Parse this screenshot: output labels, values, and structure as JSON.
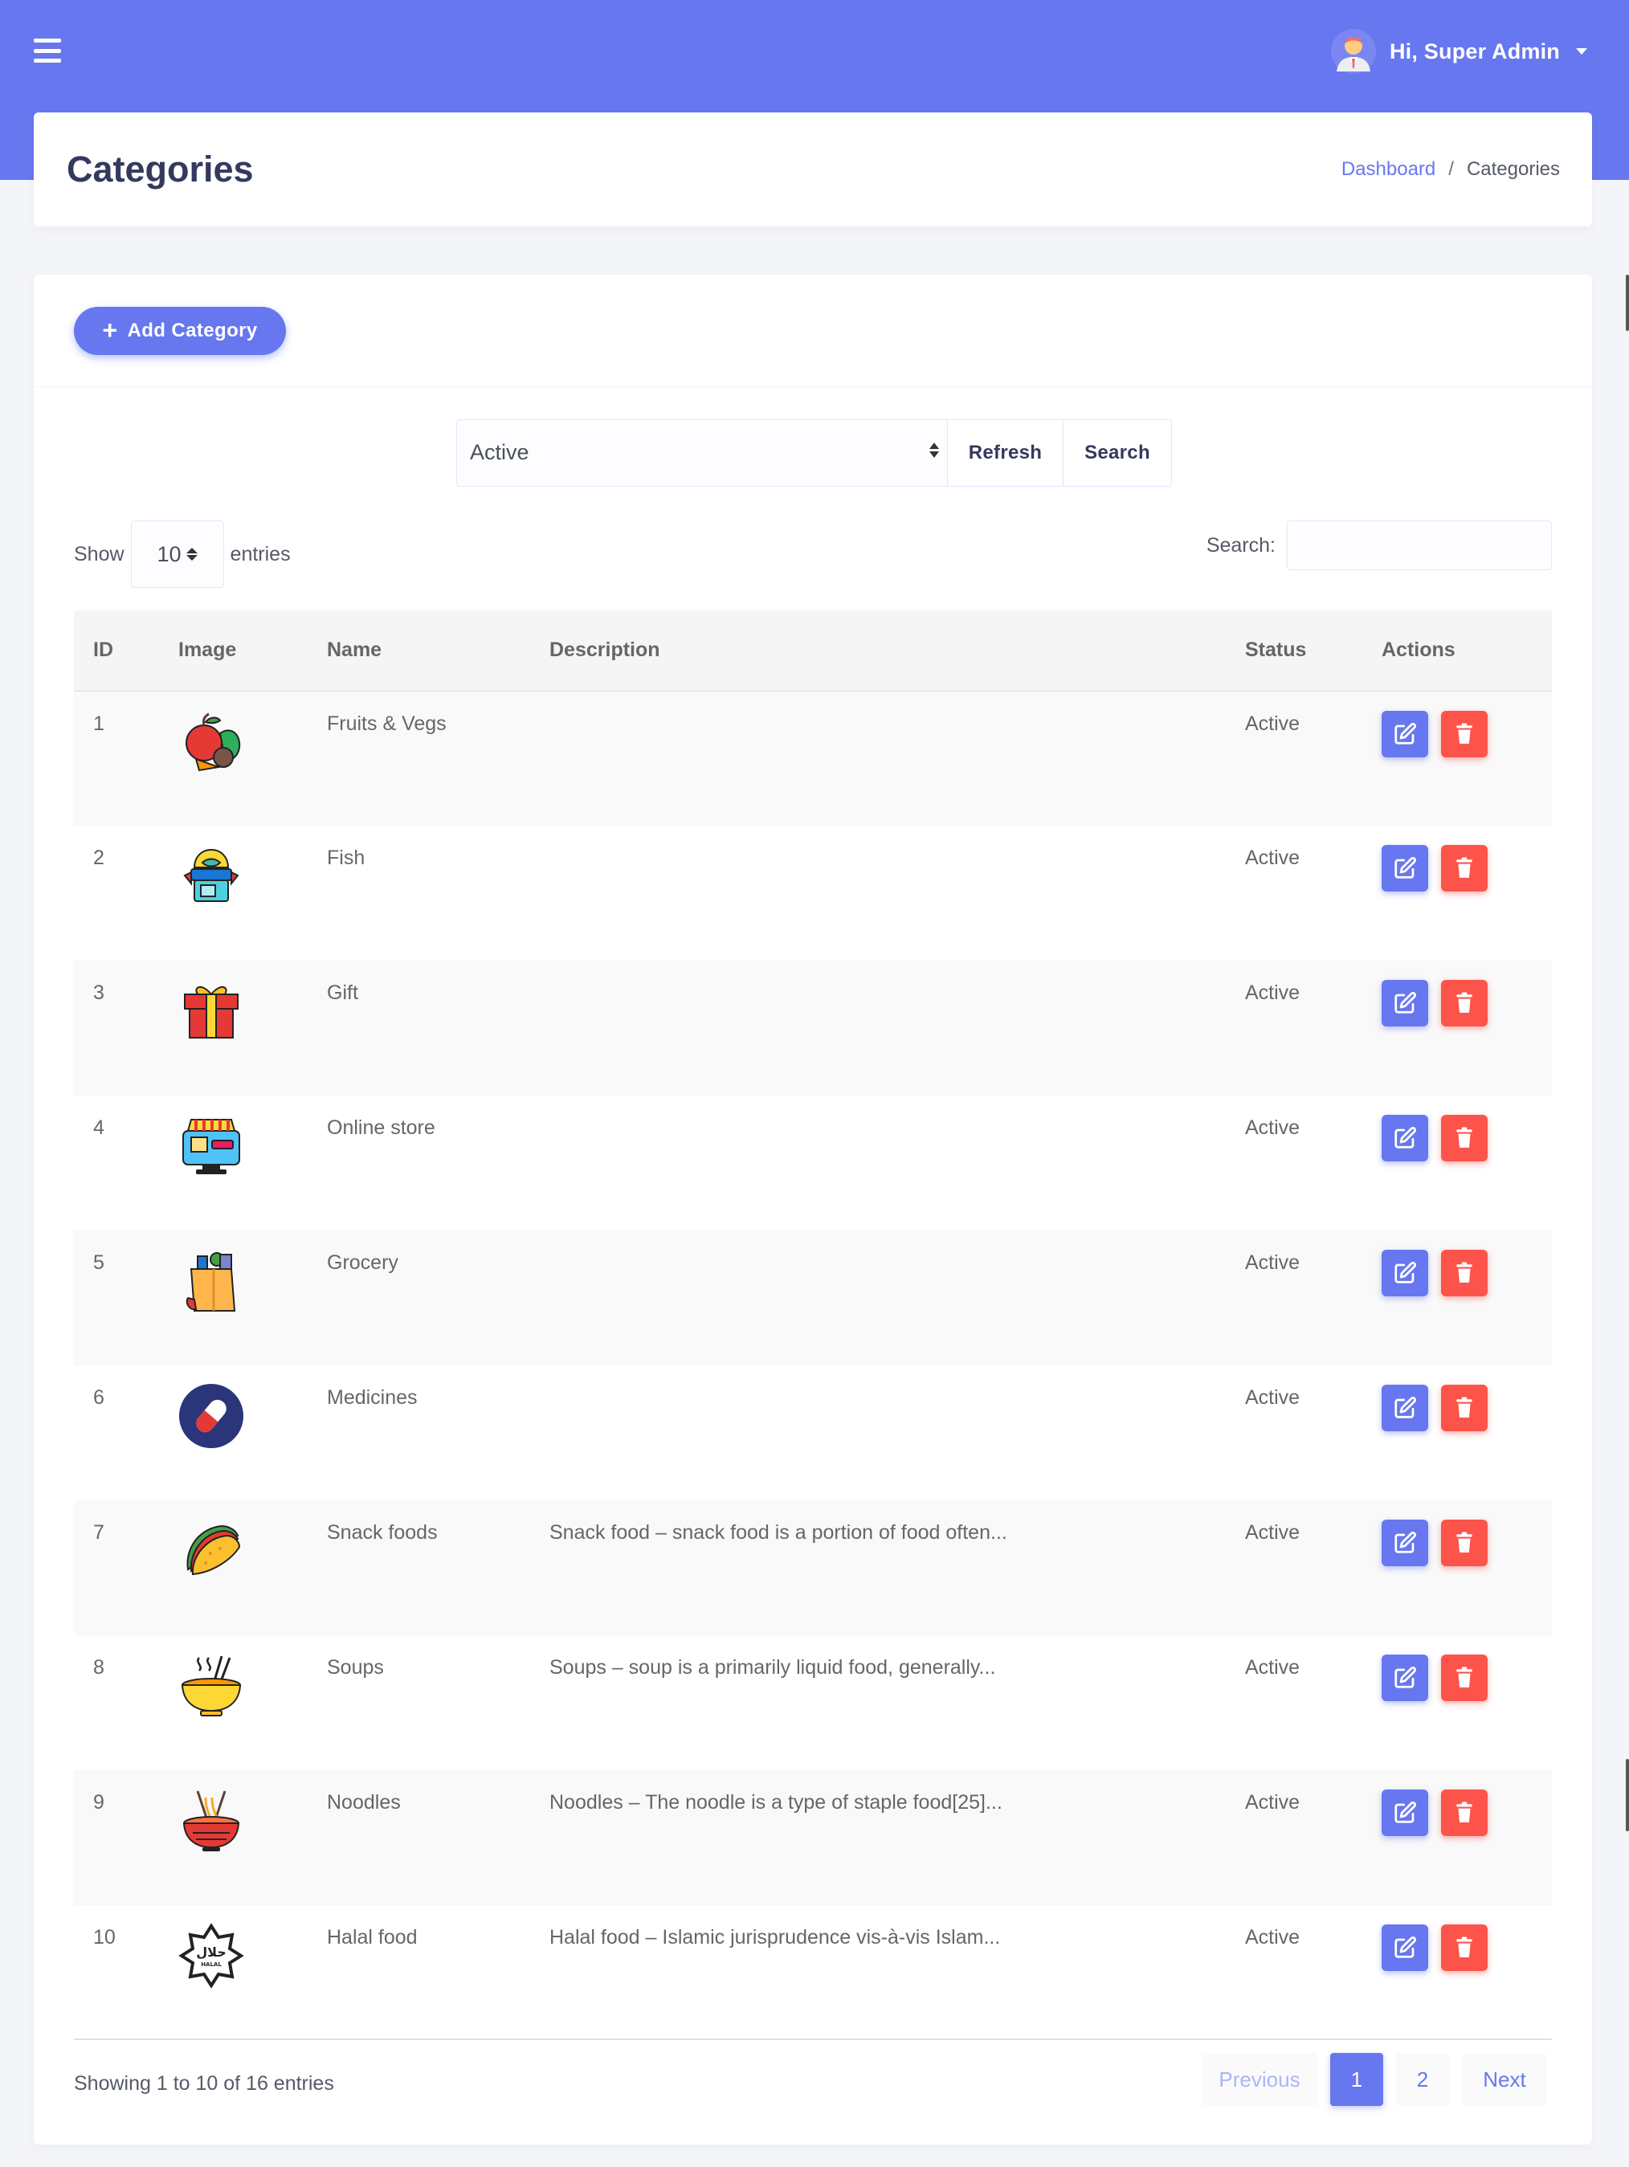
{
  "topbar": {
    "user_greeting": "Hi, Super Admin"
  },
  "header": {
    "title": "Categories",
    "breadcrumb": {
      "dashboard": "Dashboard",
      "separator": "/",
      "current": "Categories"
    }
  },
  "toolbar": {
    "add_label": "Add Category"
  },
  "filter": {
    "status_value": "Active",
    "refresh_label": "Refresh",
    "search_label": "Search"
  },
  "table_controls": {
    "show_label": "Show",
    "page_length": "10",
    "entries_label": "entries",
    "search_label": "Search:",
    "search_value": ""
  },
  "table": {
    "columns": [
      "ID",
      "Image",
      "Name",
      "Description",
      "Status",
      "Actions"
    ],
    "rows": [
      {
        "id": "1",
        "icon": "fruits-vegs-icon",
        "name": "Fruits & Vegs",
        "description": "",
        "status": "Active"
      },
      {
        "id": "2",
        "icon": "fish-shop-icon",
        "name": "Fish",
        "description": "",
        "status": "Active"
      },
      {
        "id": "3",
        "icon": "gift-icon",
        "name": "Gift",
        "description": "",
        "status": "Active"
      },
      {
        "id": "4",
        "icon": "online-store-icon",
        "name": "Online store",
        "description": "",
        "status": "Active"
      },
      {
        "id": "5",
        "icon": "grocery-bag-icon",
        "name": "Grocery",
        "description": "",
        "status": "Active"
      },
      {
        "id": "6",
        "icon": "medicine-pill-icon",
        "name": "Medicines",
        "description": "",
        "status": "Active"
      },
      {
        "id": "7",
        "icon": "taco-icon",
        "name": "Snack foods",
        "description": "Snack food – snack food is a portion of food often...",
        "status": "Active"
      },
      {
        "id": "8",
        "icon": "soup-bowl-icon",
        "name": "Soups",
        "description": "Soups – soup is a primarily liquid food, generally...",
        "status": "Active"
      },
      {
        "id": "9",
        "icon": "noodle-bowl-icon",
        "name": "Noodles",
        "description": "Noodles – The noodle is a type of staple food[25]...",
        "status": "Active"
      },
      {
        "id": "10",
        "icon": "halal-badge-icon",
        "name": "Halal food",
        "description": "Halal food – Islamic jurisprudence vis-à-vis Islam...",
        "status": "Active"
      }
    ]
  },
  "footer": {
    "info": "Showing 1 to 10 of 16 entries",
    "previous_label": "Previous",
    "pages": [
      "1",
      "2"
    ],
    "next_label": "Next"
  },
  "colors": {
    "primary": "#6777ef",
    "danger": "#fc544b",
    "title": "#34395e"
  },
  "halal_badge": {
    "arabic": "حلال",
    "latin": "HALAL"
  }
}
